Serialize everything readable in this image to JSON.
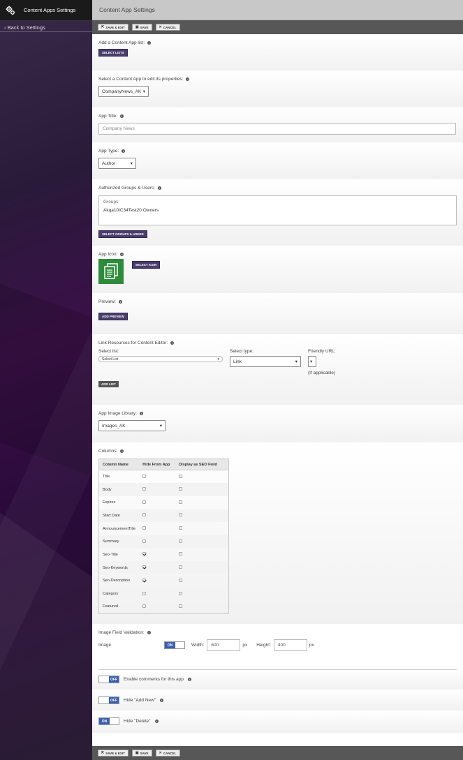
{
  "sidebar": {
    "title": "Content Apps Settings",
    "back_link": "‹ Back to Settings"
  },
  "header": {
    "title": "Content App Settings"
  },
  "toolbar": {
    "save_exit": "SAVE & EXIT",
    "save": "SAVE",
    "cancel": "CANCEL"
  },
  "add_list": {
    "label": "Add a Content App list:",
    "button": "SELECT LISTS"
  },
  "select_app": {
    "label": "Select a Content App to edit its properties:",
    "value": "CompanyNews_AK"
  },
  "app_title": {
    "label": "App Title:",
    "value": "Company News"
  },
  "app_type": {
    "label": "App Type:",
    "value": "Author"
  },
  "auth": {
    "label": "Authorized Groups & Users:",
    "groups_label": "Groups:",
    "group_value": "Akqa10IC34Test20 Owners",
    "button": "SELECT GROUPS & USERS"
  },
  "app_icon": {
    "label": "App Icon:",
    "button": "SELECT ICON"
  },
  "preview": {
    "label": "Preview:",
    "button": "ADD PREVIEW"
  },
  "link_resources": {
    "label": "Link Resources for Content Editor:",
    "select_list_label": "Select list:",
    "select_list_value": "Select List",
    "select_type_label": "Select type:",
    "select_type_value": "Link",
    "friendly_url_label": "Friendly URL:",
    "friendly_url_note": "(If applicable)",
    "button": "ADD LIST"
  },
  "image_library": {
    "label": "App Image Library:",
    "value": "Images_AK"
  },
  "columns": {
    "label": "Columns:",
    "headers": [
      "Column Name",
      "Hide From App",
      "Display as SEO Field"
    ],
    "rows": [
      {
        "name": "Title",
        "hide": false,
        "seo": false
      },
      {
        "name": "Body",
        "hide": false,
        "seo": false
      },
      {
        "name": "Expires",
        "hide": false,
        "seo": false
      },
      {
        "name": "Start Date",
        "hide": false,
        "seo": false
      },
      {
        "name": "AnnouncementTitle",
        "hide": false,
        "seo": false
      },
      {
        "name": "Summary",
        "hide": false,
        "seo": false
      },
      {
        "name": "Seo-Title",
        "hide": true,
        "seo": false
      },
      {
        "name": "Seo-Keywords",
        "hide": true,
        "seo": false
      },
      {
        "name": "Seo-Description",
        "hide": true,
        "seo": false
      },
      {
        "name": "Category",
        "hide": false,
        "seo": false
      },
      {
        "name": "Featured",
        "hide": false,
        "seo": false
      }
    ]
  },
  "image_validation": {
    "label": "Image Field Validation:",
    "field": "Image",
    "toggle": "ON",
    "width_label": "Width:",
    "width_value": "600",
    "height_label": "Height:",
    "height_value": "400",
    "unit": "px"
  },
  "comments": {
    "toggle": "OFF",
    "label": "Enable comments for this app"
  },
  "hide_add_new": {
    "toggle": "OFF",
    "label": "Hide \"Add New\""
  },
  "hide_delete": {
    "toggle": "ON",
    "label": "Hide \"Delete\""
  },
  "colors": {
    "accent_purple": "#4a3d6b",
    "toggle_blue": "#3a5fb0",
    "icon_green": "#2e8b3c"
  }
}
